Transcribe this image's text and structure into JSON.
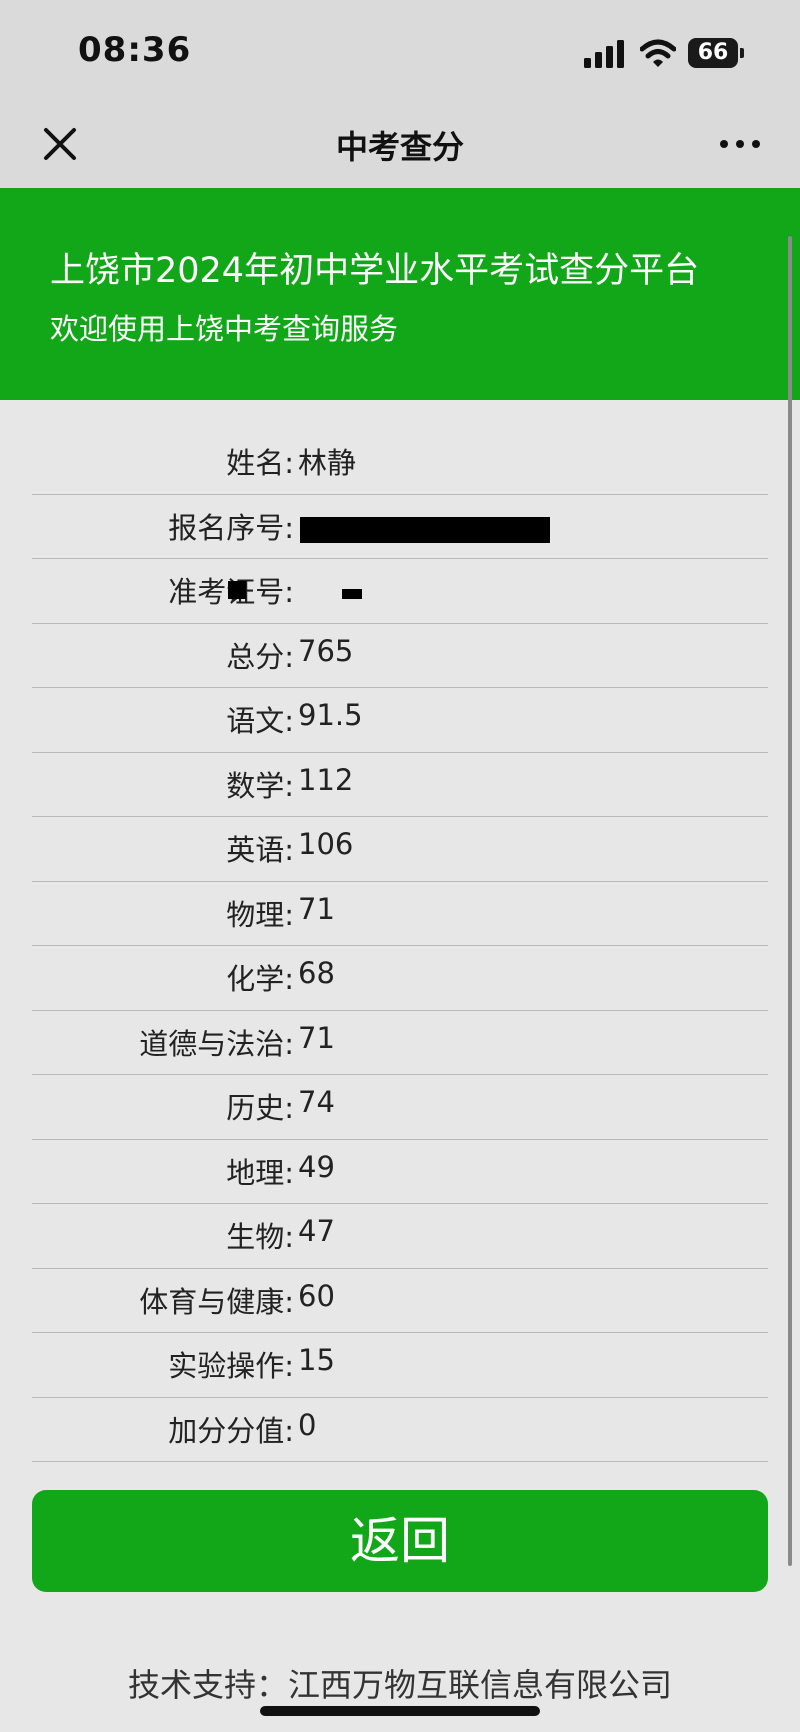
{
  "status_bar": {
    "time": "08:36",
    "battery_level": "66",
    "icons": [
      "signal-icon",
      "wifi-icon",
      "battery-icon"
    ]
  },
  "nav": {
    "title": "中考查分",
    "left_icon": "close-icon",
    "right_icon": "more-icon"
  },
  "banner": {
    "title": "上饶市2024年初中学业水平考试查分平台",
    "subtitle": "欢迎使用上饶中考查询服务",
    "background_color": "#12a718"
  },
  "results": [
    {
      "label": "姓名:",
      "value": "林静"
    },
    {
      "label": "报名序号:",
      "value": ""
    },
    {
      "label": "准考证号:",
      "value": ""
    },
    {
      "label": "总分:",
      "value": "765"
    },
    {
      "label": "语文:",
      "value": "91.5"
    },
    {
      "label": "数学:",
      "value": "112"
    },
    {
      "label": "英语:",
      "value": "106"
    },
    {
      "label": "物理:",
      "value": "71"
    },
    {
      "label": "化学:",
      "value": "68"
    },
    {
      "label": "道德与法治:",
      "value": "71"
    },
    {
      "label": "历史:",
      "value": "74"
    },
    {
      "label": "地理:",
      "value": "49"
    },
    {
      "label": "生物:",
      "value": "47"
    },
    {
      "label": "体育与健康:",
      "value": "60"
    },
    {
      "label": "实验操作:",
      "value": "15"
    },
    {
      "label": "加分分值:",
      "value": "0"
    }
  ],
  "back_button": {
    "label": "返回"
  },
  "footer": {
    "text": "技术支持：江西万物互联信息有限公司"
  }
}
